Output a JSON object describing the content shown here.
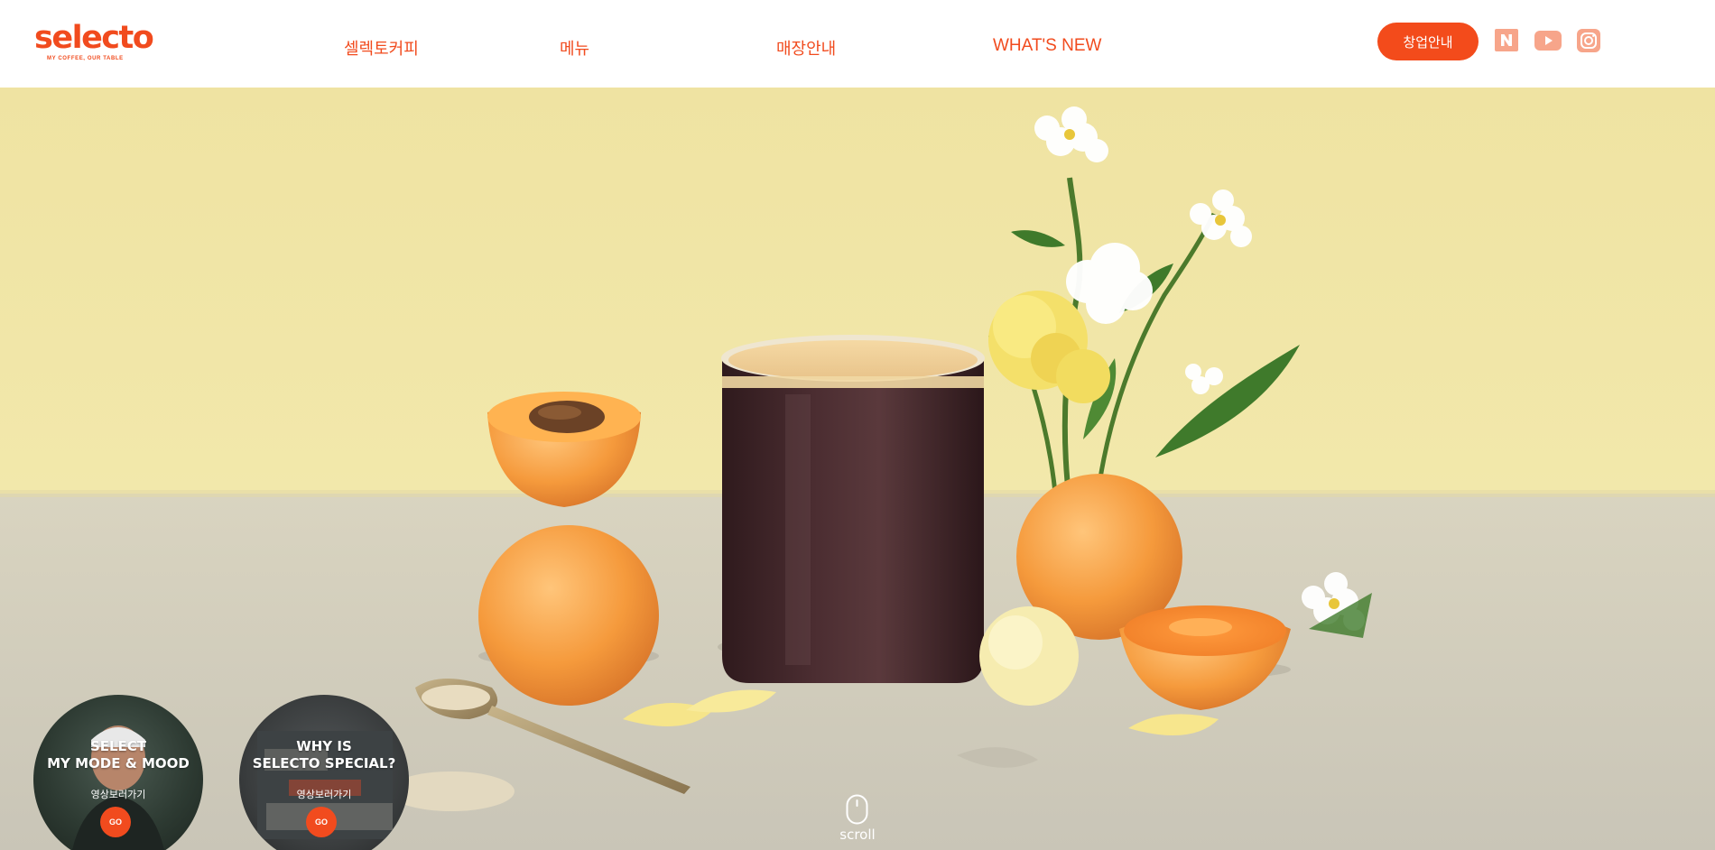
{
  "brand": {
    "name": "selecto",
    "tagline": "MY COFFEE, OUR TABLE",
    "accent_color": "#f14b1e"
  },
  "nav": {
    "items": [
      {
        "label": "셀렉토커피"
      },
      {
        "label": "메뉴"
      },
      {
        "label": "매장안내"
      },
      {
        "label": "WHAT'S NEW"
      }
    ]
  },
  "header": {
    "franchise_label": "창업안내",
    "social": [
      {
        "icon": "naver-blog-icon"
      },
      {
        "icon": "youtube-icon"
      },
      {
        "icon": "instagram-icon"
      }
    ]
  },
  "hero": {
    "video_cards": [
      {
        "title_line1": "SELECT",
        "title_line2": "MY MODE & MOOD",
        "subtitle": "영상보러가기",
        "go_label": "GO"
      },
      {
        "title_line1": "WHY IS",
        "title_line2": "SELECTO SPECIAL?",
        "subtitle": "영상보러가기",
        "go_label": "GO"
      }
    ],
    "scroll_label": "scroll"
  }
}
